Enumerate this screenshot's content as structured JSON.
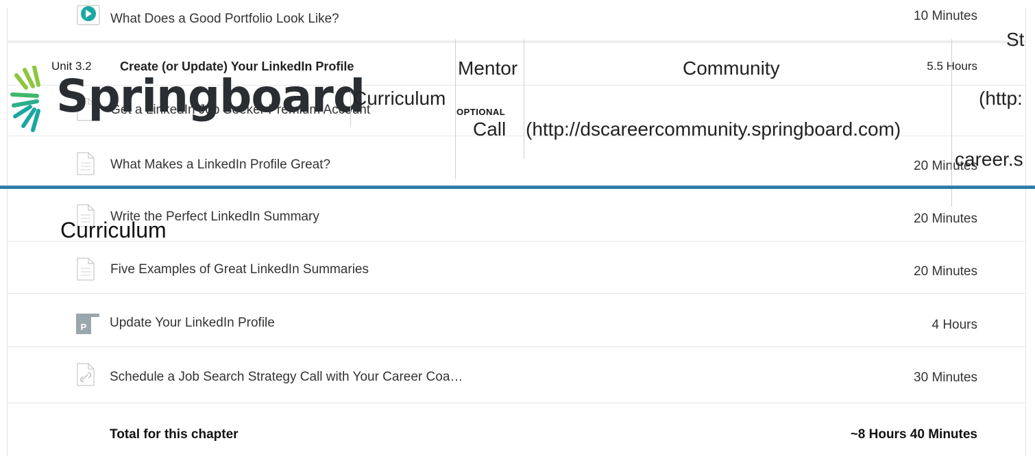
{
  "header": {
    "brand": "Springboard",
    "nav_curriculum": "Curriculum",
    "nav_mentor_line1": "Mentor",
    "nav_mentor_line2": "Call",
    "nav_community": "Community",
    "nav_community_url": "(http://dscareercommunity.springboard.com)",
    "nav_st": "St",
    "nav_http": "(http:",
    "nav_career": "career.s"
  },
  "page": {
    "heading": "Curriculum"
  },
  "lessons_top": [
    {
      "title": "What Does a Good Portfolio Look Like?",
      "duration": "10 Minutes",
      "icon": "video-play-icon"
    }
  ],
  "unit": {
    "number": "Unit 3.2",
    "title": "Create (or Update) Your LinkedIn Profile",
    "duration": "5.5 Hours"
  },
  "lessons": [
    {
      "title": "Get a LinkedIn Job Seeker Premium Account",
      "duration": "",
      "badge": "OPTIONAL",
      "icon": "document-icon"
    },
    {
      "title": "What Makes a LinkedIn Profile Great?",
      "duration": "20 Minutes",
      "icon": "document-icon"
    },
    {
      "title": "Write the Perfect LinkedIn Summary",
      "duration": "20 Minutes",
      "icon": "document-icon"
    },
    {
      "title": "Five Examples of Great LinkedIn Summaries",
      "duration": "20 Minutes",
      "icon": "document-icon"
    },
    {
      "title": "Update Your LinkedIn Profile",
      "duration": "4 Hours",
      "icon": "project-folder-icon"
    },
    {
      "title": "Schedule a Job Search Strategy Call with Your Career Coa…",
      "duration": "30 Minutes",
      "icon": "link-document-icon"
    }
  ],
  "total": {
    "label": "Total for this chapter",
    "value": "~8 Hours 40 Minutes"
  },
  "colors": {
    "header_rule": "#2e7ea6",
    "logo_green": "#8cc63f",
    "logo_teal": "#1aa7a0",
    "video_teal": "#19a9a2"
  }
}
